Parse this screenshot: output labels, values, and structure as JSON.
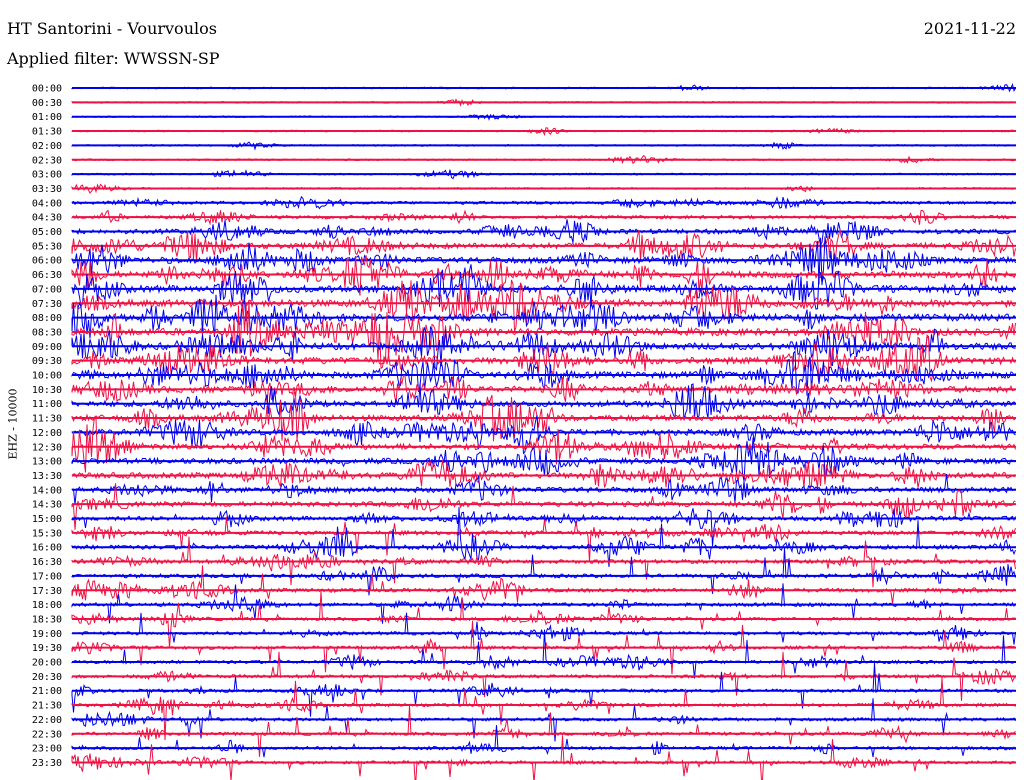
{
  "header": {
    "station": "HT Santorini - Vourvoulos",
    "date": "2021-11-22",
    "filter": "Applied filter: WWSSN-SP"
  },
  "side_label": "EHZ - 10000",
  "colors": {
    "trace_a": "#0000ee",
    "trace_b": "#ee1144",
    "background": "#ffffff"
  },
  "chart_data": {
    "type": "line",
    "title": "HT Santorini - Vourvoulos",
    "ylabel": "EHZ - 10000",
    "subtitle": "Applied filter: WWSSN-SP",
    "row_labels": [
      "00:00",
      "00:30",
      "01:00",
      "01:30",
      "02:00",
      "02:30",
      "03:00",
      "03:30",
      "04:00",
      "04:30",
      "05:00",
      "05:30",
      "06:00",
      "06:30",
      "07:00",
      "07:30",
      "08:00",
      "08:30",
      "09:00",
      "09:30",
      "10:00",
      "10:30",
      "11:00",
      "11:30",
      "12:00",
      "12:30",
      "13:00",
      "13:30",
      "14:00",
      "14:30",
      "15:00",
      "15:30",
      "16:00",
      "16:30",
      "17:00",
      "17:30",
      "18:00",
      "18:30",
      "19:00",
      "19:30",
      "20:00",
      "20:30",
      "21:00",
      "21:30",
      "22:00",
      "22:30",
      "23:00",
      "23:30"
    ],
    "series_colors": [
      "#0000ee",
      "#ee1144"
    ],
    "row_activity": [
      0.08,
      0.07,
      0.06,
      0.08,
      0.08,
      0.09,
      0.1,
      0.12,
      0.3,
      0.35,
      0.6,
      0.75,
      0.85,
      0.9,
      0.95,
      1.0,
      1.0,
      1.0,
      0.95,
      0.9,
      0.9,
      0.85,
      0.8,
      0.8,
      0.8,
      0.75,
      0.75,
      0.75,
      0.7,
      0.65,
      0.55,
      0.5,
      0.5,
      0.45,
      0.45,
      0.45,
      0.4,
      0.35,
      0.35,
      0.35,
      0.35,
      0.35,
      0.35,
      0.35,
      0.35,
      0.35,
      0.35,
      0.35
    ],
    "row_spikes": [
      0.0,
      0.0,
      0.0,
      0.0,
      0.0,
      0.0,
      0.0,
      0.0,
      0.0,
      0.0,
      0.0,
      0.0,
      0.0,
      0.0,
      0.0,
      0.0,
      0.0,
      0.0,
      0.0,
      0.0,
      0.0,
      0.0,
      0.0,
      0.0,
      0.0,
      0.0,
      0.05,
      0.1,
      0.2,
      0.3,
      0.5,
      0.6,
      0.8,
      0.8,
      0.8,
      0.8,
      0.8,
      0.85,
      0.9,
      0.9,
      0.9,
      0.9,
      0.9,
      0.9,
      0.9,
      0.9,
      0.9,
      0.9
    ],
    "xlabel": ""
  }
}
